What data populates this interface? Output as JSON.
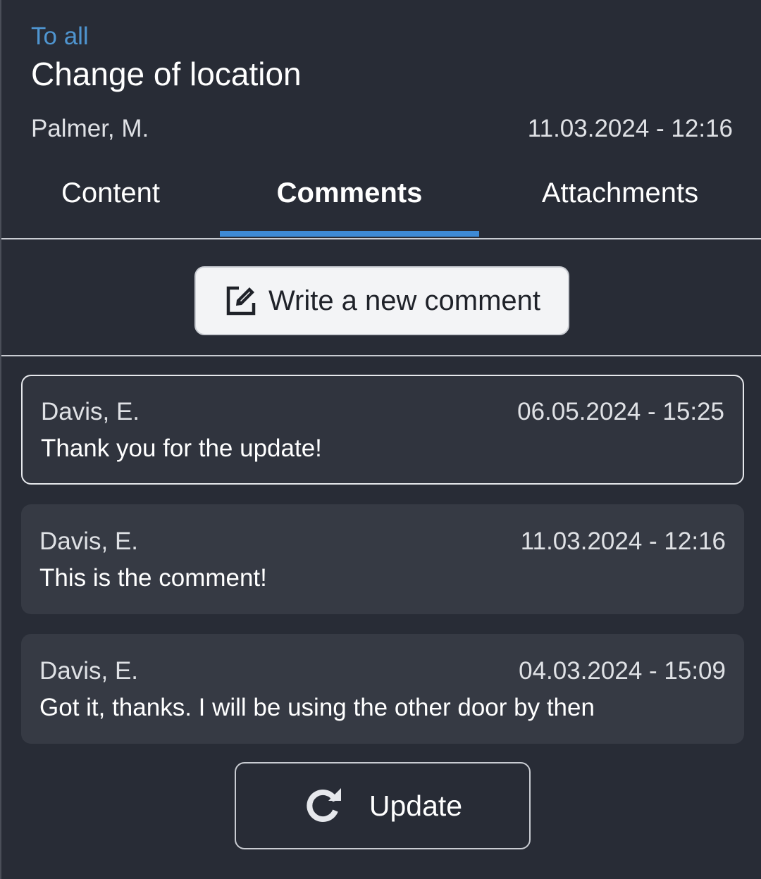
{
  "header": {
    "audience": "To all",
    "title": "Change of location",
    "author": "Palmer, M.",
    "date": "11.03.2024 - 12:16"
  },
  "tabs": [
    {
      "label": "Content",
      "active": false
    },
    {
      "label": "Comments",
      "active": true
    },
    {
      "label": "Attachments",
      "active": false
    }
  ],
  "write_button": {
    "label": "Write a new comment",
    "icon": "edit-icon"
  },
  "comments": [
    {
      "author": "Davis, E.",
      "date": "06.05.2024 - 15:25",
      "text": "Thank you for the update!",
      "selected": true
    },
    {
      "author": "Davis, E.",
      "date": "11.03.2024 - 12:16",
      "text": "This is the comment!",
      "selected": false
    },
    {
      "author": "Davis, E.",
      "date": "04.03.2024 - 15:09",
      "text": "Got it, thanks. I will be using the other door by then",
      "selected": false
    }
  ],
  "update_button": {
    "label": "Update",
    "icon": "refresh-icon"
  },
  "colors": {
    "background": "#282c36",
    "accent": "#3d8ad6",
    "audience_link": "#4f95d0",
    "card": "#363a44"
  }
}
